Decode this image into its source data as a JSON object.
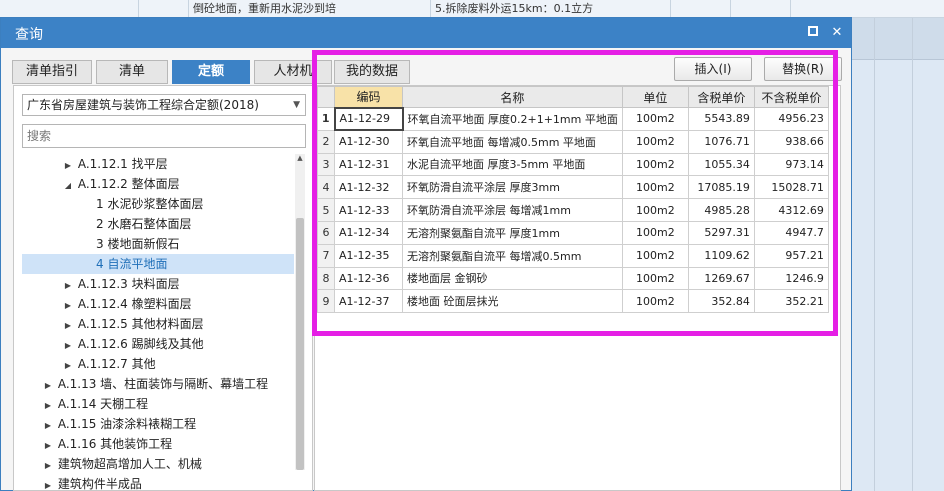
{
  "background": {
    "text_1": "倒砼地面，重新用水泥沙到培",
    "text_2": "5.拆除废料外运15km：0.1立方"
  },
  "dialog": {
    "title": "查询",
    "maximize_icon": "maximize-icon",
    "close_icon": "close-icon"
  },
  "tabs": [
    "清单指引",
    "清单",
    "定额",
    "人材机",
    "我的数据"
  ],
  "active_tab": "定额",
  "left": {
    "quota_select": "广东省房屋建筑与装饰工程综合定额(2018)",
    "search_placeholder": "搜索",
    "tree": [
      {
        "label": "A.1.12.1 找平层",
        "caret": "▶"
      },
      {
        "label": "A.1.12.2 整体面层",
        "caret": "◢"
      },
      {
        "label": "1 水泥砂浆整体面层",
        "caret": ""
      },
      {
        "label": "2 水磨石整体面层",
        "caret": ""
      },
      {
        "label": "3 楼地面新假石",
        "caret": ""
      },
      {
        "label": "4 自流平地面",
        "caret": ""
      },
      {
        "label": "A.1.12.3 块料面层",
        "caret": "▶"
      },
      {
        "label": "A.1.12.4 橡塑料面层",
        "caret": "▶"
      },
      {
        "label": "A.1.12.5 其他材料面层",
        "caret": "▶"
      },
      {
        "label": "A.1.12.6 踢脚线及其他",
        "caret": "▶"
      },
      {
        "label": "A.1.12.7 其他",
        "caret": "▶"
      },
      {
        "label": "A.1.13 墙、柱面装饰与隔断、幕墙工程",
        "caret": "▶"
      },
      {
        "label": "A.1.14 天棚工程",
        "caret": "▶"
      },
      {
        "label": "A.1.15 油漆涂料裱糊工程",
        "caret": "▶"
      },
      {
        "label": "A.1.16 其他装饰工程",
        "caret": "▶"
      },
      {
        "label": "建筑物超高增加人工、机械",
        "caret": "▶"
      },
      {
        "label": "建筑构件半成品",
        "caret": "▶"
      }
    ],
    "selected_item": "4 自流平地面"
  },
  "right": {
    "insert_button": "插入(I)",
    "replace_button": "替换(R)",
    "columns": [
      "编码",
      "名称",
      "单位",
      "含税单价",
      "不含税单价"
    ],
    "rows": [
      {
        "no": "1",
        "code": "A1-12-29",
        "name": "环氧自流平地面 厚度0.2+1+1mm 平地面",
        "unit": "100m2",
        "tax_price": "5543.89",
        "price": "4956.23"
      },
      {
        "no": "2",
        "code": "A1-12-30",
        "name": "环氧自流平地面 每增减0.5mm 平地面",
        "unit": "100m2",
        "tax_price": "1076.71",
        "price": "938.66"
      },
      {
        "no": "3",
        "code": "A1-12-31",
        "name": "水泥自流平地面 厚度3-5mm 平地面",
        "unit": "100m2",
        "tax_price": "1055.34",
        "price": "973.14"
      },
      {
        "no": "4",
        "code": "A1-12-32",
        "name": "环氧防滑自流平涂层 厚度3mm",
        "unit": "100m2",
        "tax_price": "17085.19",
        "price": "15028.71"
      },
      {
        "no": "5",
        "code": "A1-12-33",
        "name": "环氧防滑自流平涂层 每增减1mm",
        "unit": "100m2",
        "tax_price": "4985.28",
        "price": "4312.69"
      },
      {
        "no": "6",
        "code": "A1-12-34",
        "name": "无溶剂聚氨酯自流平 厚度1mm",
        "unit": "100m2",
        "tax_price": "5297.31",
        "price": "4947.7"
      },
      {
        "no": "7",
        "code": "A1-12-35",
        "name": "无溶剂聚氨酯自流平 每增减0.5mm",
        "unit": "100m2",
        "tax_price": "1109.62",
        "price": "957.21"
      },
      {
        "no": "8",
        "code": "A1-12-36",
        "name": "楼地面层 金钢砂",
        "unit": "100m2",
        "tax_price": "1269.67",
        "price": "1246.9"
      },
      {
        "no": "9",
        "code": "A1-12-37",
        "name": "楼地面 砼面层抹光",
        "unit": "100m2",
        "tax_price": "352.84",
        "price": "352.21"
      }
    ]
  },
  "colors": {
    "accent": "#3c82c6",
    "highlight_box": "#e51fe5",
    "selected_header": "#f8e2a8"
  }
}
